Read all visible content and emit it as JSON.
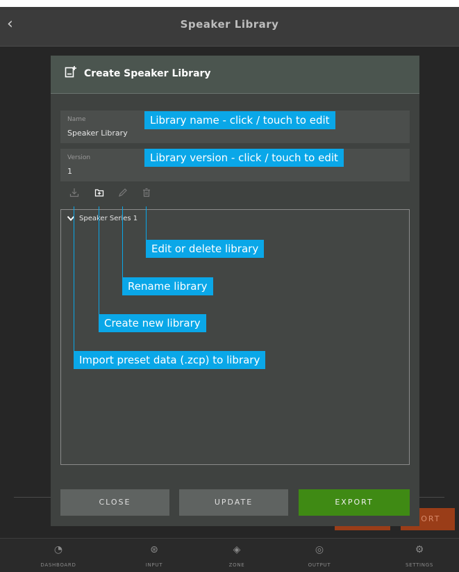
{
  "header": {
    "back_glyph": "‹",
    "title": "Speaker Library"
  },
  "background": {
    "buttons": [
      "",
      "PORT"
    ]
  },
  "modal": {
    "title": "Create Speaker Library",
    "name_field": {
      "label": "Name",
      "value": "Speaker Library"
    },
    "version_field": {
      "label": "Version",
      "value": "1"
    },
    "tree": {
      "items": [
        {
          "label": "Speaker Series 1"
        }
      ]
    },
    "buttons": {
      "close": "CLOSE",
      "update": "UPDATE",
      "export": "EXPORT"
    }
  },
  "annotations": {
    "name_tip": "Library name - click / touch to edit",
    "version_tip": "Library version - click / touch to edit",
    "edit_delete_tip": "Edit or delete library",
    "rename_tip": "Rename library",
    "create_tip": "Create new library",
    "import_tip": "Import preset data (.zcp) to library"
  },
  "nav": [
    {
      "label": "DASHBOARD",
      "icon": "dashboard-icon"
    },
    {
      "label": "INPUT",
      "icon": "input-icon"
    },
    {
      "label": "ZONE",
      "icon": "zone-icon"
    },
    {
      "label": "OUTPUT",
      "icon": "output-icon"
    },
    {
      "label": "SETTINGS",
      "icon": "settings-icon"
    }
  ],
  "colors": {
    "accent": "#0aa7e8",
    "export": "#3f8a14",
    "background": "#262626"
  }
}
